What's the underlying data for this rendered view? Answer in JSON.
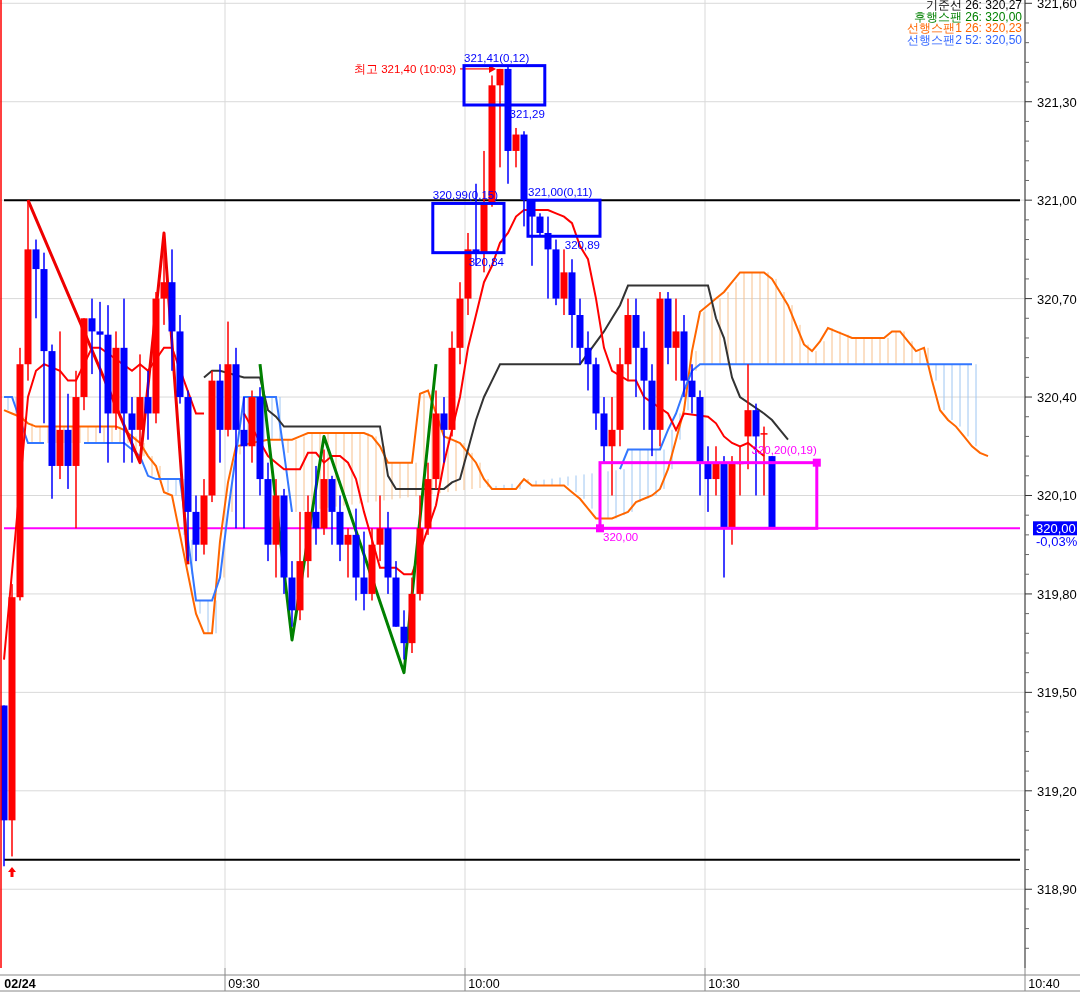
{
  "legend": [
    {
      "text": "기준선 26: 320,27",
      "color": "#000000"
    },
    {
      "text": "후행스팬 26: 320,00",
      "color": "#008000"
    },
    {
      "text": "선행스팬1 26: 320,23",
      "color": "#ff6600"
    },
    {
      "text": "선행스팬2 52: 320,50",
      "color": "#3366ff"
    }
  ],
  "last_price": {
    "text": "320,00",
    "change": "-0,03%"
  },
  "price_chart": {
    "chart_data": {
      "type": "candlestick",
      "ylim": [
        318.66,
        321.61
      ],
      "yticks": [
        {
          "value": 321.6,
          "label": "321,60"
        },
        {
          "value": 321.3,
          "label": "321,30"
        },
        {
          "value": 321.0,
          "label": "321,00"
        },
        {
          "value": 320.7,
          "label": "320,70"
        },
        {
          "value": 320.4,
          "label": "320,40"
        },
        {
          "value": 320.1,
          "label": "320,10"
        },
        {
          "value": 319.8,
          "label": "319,80"
        },
        {
          "value": 319.5,
          "label": "319,50"
        },
        {
          "value": 319.2,
          "label": "319,20"
        },
        {
          "value": 318.9,
          "label": "318,90"
        }
      ],
      "categories": [
        null,
        null,
        "02/24",
        null,
        null,
        null,
        null,
        null,
        null,
        null,
        null,
        null,
        null,
        null,
        null,
        null,
        null,
        null,
        null,
        null,
        null,
        null,
        null,
        null,
        null,
        null,
        null,
        null,
        null,
        null,
        "09:30",
        null,
        null,
        null,
        null,
        null,
        null,
        null,
        null,
        null,
        null,
        null,
        null,
        null,
        null,
        null,
        null,
        null,
        null,
        null,
        null,
        null,
        null,
        null,
        null,
        null,
        null,
        null,
        null,
        null,
        "10:00",
        null,
        null,
        null,
        null,
        null,
        null,
        null,
        null,
        null,
        null,
        null,
        null,
        null,
        null,
        null,
        null,
        null,
        null,
        null,
        null,
        null,
        null,
        null,
        null,
        null,
        null,
        null,
        null,
        null,
        "10:30",
        null,
        null,
        null,
        null,
        null,
        null,
        null,
        null,
        null,
        null,
        null,
        null,
        null,
        null,
        null,
        null,
        null,
        null,
        null,
        null,
        null,
        null,
        null,
        null,
        null,
        null,
        null,
        null,
        null,
        null,
        null,
        null,
        null,
        null,
        null,
        null,
        null,
        null,
        null,
        "10:40"
      ],
      "ohlc": [
        [
          319.46,
          319.46,
          318.97,
          319.11
        ],
        [
          319.11,
          319.83,
          319.0,
          319.79
        ],
        [
          319.79,
          320.55,
          319.78,
          320.5
        ],
        [
          320.5,
          321.0,
          320.45,
          320.85
        ],
        [
          320.85,
          320.88,
          320.64,
          320.79
        ],
        [
          320.79,
          320.84,
          320.32,
          320.54
        ],
        [
          320.54,
          320.56,
          320.09,
          320.19
        ],
        [
          320.19,
          320.6,
          320.15,
          320.3
        ],
        [
          320.3,
          320.41,
          320.12,
          320.19
        ],
        [
          320.19,
          320.48,
          320.0,
          320.4
        ],
        [
          320.4,
          320.64,
          320.36,
          320.64
        ],
        [
          320.64,
          320.7,
          320.47,
          320.6
        ],
        [
          320.6,
          320.69,
          320.29,
          320.59
        ],
        [
          320.59,
          320.68,
          320.2,
          320.35
        ],
        [
          320.35,
          320.6,
          320.3,
          320.55
        ],
        [
          320.55,
          320.7,
          320.2,
          320.35
        ],
        [
          320.35,
          320.4,
          320.2,
          320.3
        ],
        [
          320.3,
          320.53,
          320.25,
          320.4
        ],
        [
          320.4,
          320.48,
          320.27,
          320.35
        ],
        [
          320.35,
          320.72,
          320.32,
          320.7
        ],
        [
          320.7,
          320.9,
          320.62,
          320.75
        ],
        [
          320.75,
          320.85,
          320.48,
          320.6
        ],
        [
          320.6,
          320.65,
          320.38,
          320.4
        ],
        [
          320.4,
          320.42,
          319.9,
          320.05
        ],
        [
          320.05,
          320.1,
          319.9,
          319.95
        ],
        [
          319.95,
          320.15,
          319.92,
          320.1
        ],
        [
          320.1,
          320.48,
          320.08,
          320.45
        ],
        [
          320.45,
          320.5,
          320.2,
          320.3
        ],
        [
          320.3,
          320.63,
          320.28,
          320.5
        ],
        [
          320.5,
          320.55,
          320.0,
          320.3
        ],
        [
          320.3,
          320.4,
          320.0,
          320.25
        ],
        [
          320.25,
          320.42,
          320.2,
          320.4
        ],
        [
          320.4,
          320.43,
          320.1,
          320.15
        ],
        [
          320.15,
          320.2,
          319.9,
          319.95
        ],
        [
          319.95,
          320.15,
          319.85,
          320.1
        ],
        [
          320.1,
          320.12,
          319.8,
          319.85
        ],
        [
          319.85,
          319.9,
          319.7,
          319.75
        ],
        [
          319.75,
          320.05,
          319.72,
          319.9
        ],
        [
          319.9,
          320.1,
          319.85,
          320.05
        ],
        [
          320.05,
          320.19,
          319.95,
          320.0
        ],
        [
          320.0,
          320.24,
          319.98,
          320.15
        ],
        [
          320.15,
          320.16,
          319.95,
          320.05
        ],
        [
          320.05,
          320.1,
          319.9,
          319.95
        ],
        [
          319.95,
          320.0,
          319.85,
          319.98
        ],
        [
          319.98,
          320.06,
          319.78,
          319.85
        ],
        [
          319.85,
          319.99,
          319.75,
          319.8
        ],
        [
          319.8,
          320.0,
          319.78,
          319.95
        ],
        [
          319.95,
          320.1,
          319.9,
          320.0
        ],
        [
          320.0,
          320.05,
          319.8,
          319.85
        ],
        [
          319.85,
          319.9,
          319.7,
          319.7
        ],
        [
          319.7,
          319.75,
          319.6,
          319.65
        ],
        [
          319.65,
          319.85,
          319.62,
          319.8
        ],
        [
          319.8,
          320.1,
          319.78,
          320.0
        ],
        [
          320.0,
          320.2,
          319.98,
          320.15
        ],
        [
          320.15,
          320.42,
          320.12,
          320.35
        ],
        [
          320.35,
          320.4,
          320.2,
          320.3
        ],
        [
          320.3,
          320.6,
          320.28,
          320.55
        ],
        [
          320.55,
          320.75,
          320.5,
          320.7
        ],
        [
          320.7,
          320.9,
          320.65,
          320.85
        ],
        [
          320.85,
          321.05,
          320.8,
          320.84
        ],
        [
          320.84,
          321.15,
          320.78,
          320.99
        ],
        [
          320.99,
          321.38,
          320.98,
          321.35
        ],
        [
          321.35,
          321.4,
          321.1,
          321.4
        ],
        [
          321.4,
          321.41,
          321.05,
          321.15
        ],
        [
          321.15,
          321.22,
          321.1,
          321.2
        ],
        [
          321.2,
          321.21,
          320.92,
          321.0
        ],
        [
          321.0,
          321.0,
          320.8,
          320.95
        ],
        [
          320.95,
          320.96,
          320.89,
          320.9
        ],
        [
          320.9,
          320.95,
          320.7,
          320.85
        ],
        [
          320.85,
          320.88,
          320.68,
          320.7
        ],
        [
          320.7,
          320.85,
          320.65,
          320.78
        ],
        [
          320.78,
          320.82,
          320.55,
          320.65
        ],
        [
          320.65,
          320.7,
          320.5,
          320.55
        ],
        [
          320.55,
          320.6,
          320.42,
          320.5
        ],
        [
          320.5,
          320.52,
          320.3,
          320.35
        ],
        [
          320.35,
          320.4,
          320.2,
          320.25
        ],
        [
          320.25,
          320.4,
          320.1,
          320.3
        ],
        [
          320.3,
          320.55,
          320.25,
          320.5
        ],
        [
          320.5,
          320.7,
          320.45,
          320.65
        ],
        [
          320.65,
          320.7,
          320.4,
          320.55
        ],
        [
          320.55,
          320.6,
          320.3,
          320.45
        ],
        [
          320.45,
          320.5,
          320.22,
          320.3
        ],
        [
          320.3,
          320.72,
          320.25,
          320.7
        ],
        [
          320.7,
          320.72,
          320.5,
          320.55
        ],
        [
          320.55,
          320.7,
          320.45,
          320.6
        ],
        [
          320.6,
          320.65,
          320.4,
          320.45
        ],
        [
          320.45,
          320.5,
          320.35,
          320.4
        ],
        [
          320.4,
          320.42,
          320.1,
          320.2
        ],
        [
          320.2,
          320.25,
          320.05,
          320.15
        ],
        [
          320.15,
          320.25,
          320.1,
          320.2
        ],
        [
          320.2,
          320.22,
          319.85,
          320.0
        ],
        [
          320.0,
          320.22,
          319.95,
          320.2
        ],
        [
          320.2,
          320.25,
          320.1,
          320.2
        ],
        [
          320.28,
          320.5,
          320.18,
          320.36
        ],
        [
          320.36,
          320.38,
          320.1,
          320.28
        ],
        [
          320.29,
          320.31,
          320.1,
          320.29
        ],
        [
          320.22,
          320.22,
          320.0,
          320.0
        ],
        null,
        null,
        null,
        null,
        null,
        null,
        null,
        null,
        null,
        null,
        null,
        null,
        null,
        null,
        null,
        null,
        null,
        null,
        null,
        null,
        null,
        null,
        null,
        null,
        null,
        null,
        null,
        null,
        null,
        null,
        null,
        null,
        null,
        null
      ],
      "annotations": [
        "최고 321,40 (10:03)",
        "321,41(0,12)",
        "321,29",
        "320,99(0,15)",
        "320,84",
        "321,00(0,11)",
        "320,89",
        "320,20(0,19)",
        "320,00"
      ]
    }
  },
  "indicator_chart": {
    "chart_data": {
      "type": "line",
      "grid": true,
      "ylim": [
        318.66,
        321.61
      ],
      "series": [
        {
          "color": "#ff6600",
          "values": [
            320.36,
            320.35,
            320.34,
            320.32,
            320.31,
            320.31,
            null,
            320.31,
            320.31,
            null,
            320.31,
            320.31,
            320.31,
            320.31,
            320.31,
            320.3,
            320.28,
            320.26,
            320.22,
            320.19,
            320.11,
            320.1,
            319.98,
            319.86,
            319.74,
            319.68,
            319.68,
            319.96,
            320.14,
            320.25,
            null,
            null,
            null,
            320.27,
            320.27,
            320.27,
            320.27,
            320.28,
            320.29,
            320.29,
            320.29,
            320.29,
            320.29,
            320.29,
            320.29,
            320.29,
            320.28,
            320.25,
            320.2,
            320.2,
            320.2,
            320.2,
            320.41,
            320.42,
            null,
            320.28,
            320.27,
            320.26,
            320.23,
            320.2,
            320.15,
            320.12,
            320.12,
            320.12,
            320.12,
            320.15,
            320.13,
            320.13,
            320.13,
            320.13,
            320.13,
            320.11,
            320.09,
            320.06,
            320.03,
            320.03,
            320.03,
            320.04,
            320.05,
            320.08,
            320.09,
            320.1,
            320.12,
            320.18,
            320.27,
            320.36,
            320.54,
            320.66,
            320.68,
            320.7,
            320.72,
            320.75,
            320.78,
            320.78,
            320.78,
            320.78,
            320.76,
            320.72,
            320.68,
            320.62,
            320.56,
            320.54,
            320.57,
            320.61,
            320.6,
            320.59,
            320.58,
            320.58,
            320.58,
            320.58,
            320.58,
            320.6,
            320.6,
            320.57,
            320.54,
            320.55,
            320.45,
            320.36,
            320.33,
            320.31,
            320.28,
            320.25,
            320.23,
            320.22,
            null,
            null,
            null,
            null,
            null,
            null,
            null
          ]
        },
        {
          "color": "#3377ff",
          "values": [
            320.4,
            320.4,
            null,
            320.26,
            320.26,
            320.26,
            null,
            null,
            null,
            null,
            320.26,
            320.26,
            320.26,
            320.26,
            320.26,
            320.26,
            320.24,
            320.22,
            320.16,
            320.15,
            320.15,
            320.15,
            320.15,
            null,
            319.78,
            319.78,
            319.78,
            319.85,
            320.05,
            null,
            320.4,
            null,
            null,
            320.4,
            320.4,
            320.23,
            320.05,
            null,
            null,
            null,
            null,
            null,
            null,
            null,
            null,
            null,
            null,
            null,
            null,
            null,
            null,
            null,
            null,
            null,
            null,
            null,
            null,
            null,
            null,
            null,
            null,
            null,
            null,
            null,
            null,
            null,
            null,
            null,
            null,
            null,
            null,
            null,
            null,
            null,
            null,
            null,
            null,
            320.18,
            320.24,
            320.24,
            320.24,
            320.24,
            320.24,
            320.3,
            320.35,
            320.42,
            320.48,
            320.5,
            320.5,
            320.5,
            320.5,
            320.5,
            320.5,
            320.5,
            320.5,
            320.5,
            320.5,
            320.5,
            320.5,
            320.5,
            320.5,
            320.5,
            320.5,
            320.5,
            320.5,
            320.5,
            320.5,
            320.5,
            320.5,
            320.5,
            320.5,
            320.5,
            320.5,
            320.5,
            320.5,
            320.5,
            320.5,
            320.5,
            320.5,
            320.5,
            320.5,
            320.5,
            null,
            null,
            null,
            null,
            null,
            null,
            null
          ]
        },
        {
          "color": "#333333",
          "values": [
            null,
            null,
            null,
            null,
            null,
            null,
            null,
            null,
            null,
            null,
            null,
            null,
            null,
            null,
            null,
            null,
            null,
            null,
            null,
            null,
            null,
            null,
            null,
            null,
            null,
            320.46,
            320.48,
            320.48,
            null,
            null,
            320.46,
            320.46,
            320.46,
            320.36,
            320.34,
            320.31,
            320.31,
            320.31,
            320.31,
            320.31,
            320.31,
            320.31,
            320.31,
            320.31,
            320.31,
            320.31,
            320.31,
            320.31,
            320.16,
            320.12,
            320.12,
            320.12,
            320.12,
            null,
            320.12,
            320.12,
            320.14,
            320.15,
            null,
            320.33,
            320.4,
            320.45,
            320.5,
            320.5,
            320.5,
            320.5,
            320.5,
            320.5,
            320.5,
            320.5,
            320.5,
            320.5,
            320.5,
            null,
            null,
            320.6,
            320.64,
            320.68,
            320.74,
            320.74,
            320.74,
            320.74,
            320.74,
            320.74,
            320.74,
            320.74,
            320.74,
            320.74,
            320.74,
            320.64,
            320.58,
            320.46,
            320.4,
            null,
            null,
            320.35,
            320.33,
            320.3,
            320.27,
            null,
            null,
            null,
            null,
            null,
            null,
            null,
            null,
            null,
            null,
            null,
            null,
            null,
            null,
            null,
            null,
            null,
            null,
            null,
            null,
            null,
            null,
            null,
            null,
            null,
            null,
            null,
            null,
            null,
            null,
            null,
            null
          ]
        },
        {
          "color": "#ff0000",
          "values": [
            319.6,
            null,
            null,
            320.4,
            320.48,
            320.5,
            null,
            320.48,
            320.45,
            320.45,
            null,
            320.55,
            320.55,
            null,
            null,
            null,
            320.48,
            320.5,
            320.48,
            null,
            320.55,
            320.55,
            null,
            null,
            320.35,
            320.35,
            null,
            null,
            null,
            null,
            320.35,
            null,
            null,
            320.22,
            320.2,
            320.18,
            320.18,
            320.18,
            320.23,
            320.23,
            320.2,
            320.22,
            320.22,
            320.2,
            320.15,
            320.05,
            null,
            319.88,
            null,
            319.88,
            319.86,
            319.86,
            null,
            null,
            320.07,
            320.2,
            null,
            320.4,
            320.55,
            320.65,
            320.75,
            320.8,
            320.87,
            320.9,
            320.95,
            320.97,
            null,
            320.97,
            320.97,
            320.96,
            320.95,
            320.93,
            320.86,
            320.82,
            320.7,
            320.55,
            320.48,
            null,
            320.45,
            320.45,
            320.4,
            null,
            null,
            320.35,
            320.3,
            320.35,
            null,
            null,
            320.34,
            320.32,
            320.28,
            320.26,
            320.25,
            320.26,
            320.24,
            320.22,
            null,
            null,
            null,
            null,
            null,
            null,
            null,
            null,
            null,
            null,
            null,
            null,
            null,
            null,
            null,
            null,
            null,
            null,
            null,
            null,
            null,
            null,
            null,
            null,
            null,
            null,
            null,
            null,
            null,
            null,
            null,
            null,
            null,
            null,
            null
          ]
        },
        {
          "color": "#ee0000",
          "values": [
            null,
            null,
            null,
            321.0,
            null,
            null,
            null,
            null,
            null,
            null,
            null,
            null,
            null,
            null,
            null,
            null,
            null,
            320.2,
            null,
            null,
            320.9,
            null,
            null,
            319.89,
            null,
            null,
            null,
            null,
            null,
            null,
            null,
            null,
            null,
            null,
            null,
            null,
            null,
            null,
            null,
            null,
            null,
            null,
            null,
            null,
            null,
            null,
            null,
            null,
            null,
            null,
            null,
            null,
            null,
            null,
            null,
            null,
            null,
            null,
            null,
            null,
            null,
            null,
            null,
            null,
            null,
            null,
            null,
            null,
            null,
            null,
            null,
            null,
            null,
            null,
            null,
            null,
            null,
            null,
            null,
            null,
            null,
            null,
            null,
            null,
            null,
            null,
            null,
            null,
            null,
            null,
            null,
            null,
            null,
            null,
            null,
            null,
            null,
            null,
            null,
            null,
            null,
            null,
            null,
            null,
            null,
            null,
            null,
            null,
            null,
            null,
            null,
            null,
            null,
            null,
            null,
            null,
            null,
            null,
            null,
            null,
            null,
            null,
            null,
            null,
            null,
            null,
            null,
            null,
            null,
            null,
            null
          ]
        },
        {
          "color": "#008000",
          "values": [
            null,
            null,
            null,
            null,
            null,
            null,
            null,
            null,
            null,
            null,
            null,
            null,
            null,
            null,
            null,
            null,
            null,
            null,
            null,
            null,
            null,
            null,
            null,
            null,
            null,
            null,
            null,
            null,
            null,
            null,
            null,
            null,
            320.5,
            null,
            null,
            null,
            319.66,
            null,
            null,
            null,
            320.28,
            null,
            null,
            null,
            null,
            null,
            null,
            null,
            null,
            null,
            319.56,
            null,
            null,
            null,
            320.5,
            null,
            null,
            null,
            null,
            null,
            null,
            null,
            null,
            null,
            null,
            null,
            null,
            null,
            null,
            null,
            null,
            null,
            null,
            null,
            null,
            null,
            null,
            null,
            null,
            null,
            null,
            null,
            null,
            null,
            null,
            null,
            null,
            null,
            null,
            null,
            null,
            null,
            null,
            null,
            null,
            null,
            null,
            null,
            null,
            null,
            null,
            null,
            null,
            null,
            null,
            null,
            null,
            null,
            null,
            null,
            null,
            null,
            null,
            null,
            null,
            null,
            null,
            null,
            null,
            null,
            null,
            null,
            null,
            null,
            null,
            null,
            null,
            null,
            null,
            null,
            null
          ]
        },
        {
          "color": "#000000",
          "values": [
            321.0,
            321.0,
            321.0,
            null,
            321.0,
            321.0,
            321.0,
            321.0,
            321.0,
            321.0,
            321.0,
            321.0,
            321.0,
            321.0,
            321.0,
            321.0,
            321.0,
            321.0,
            321.0,
            321.0,
            321.0,
            321.0,
            321.0,
            321.0,
            321.0,
            321.0,
            321.0,
            321.0,
            321.0,
            321.0,
            321.0,
            321.0,
            321.0,
            321.0,
            321.0,
            321.0,
            321.0,
            321.0,
            321.0,
            321.0,
            321.0,
            321.0,
            321.0,
            321.0,
            321.0,
            321.0,
            321.0,
            321.0,
            321.0,
            321.0,
            321.0,
            321.0,
            321.0,
            321.0,
            null,
            null,
            null,
            null,
            null,
            null,
            null,
            null,
            null,
            321.0,
            321.0,
            null,
            null,
            null,
            null,
            null,
            null,
            null,
            null,
            null,
            null,
            321.0,
            321.0,
            321.0,
            321.0,
            321.0,
            321.0,
            321.0,
            321.0,
            321.0,
            321.0,
            321.0,
            321.0,
            321.0,
            321.0,
            321.0,
            321.0,
            321.0,
            321.0,
            321.0,
            321.0,
            321.0,
            321.0,
            321.0,
            321.0,
            321.0,
            321.0,
            321.0,
            321.0,
            321.0,
            321.0,
            321.0,
            321.0,
            321.0,
            321.0,
            321.0,
            321.0,
            321.0,
            321.0,
            321.0,
            321.0,
            321.0,
            321.0,
            321.0,
            321.0,
            321.0,
            321.0,
            321.0,
            321.0,
            321.0,
            321.0,
            321.0,
            321.0,
            321.0,
            null,
            null,
            null
          ]
        },
        {
          "color": "#000000",
          "values": [
            318.99,
            318.99,
            318.99,
            318.99,
            318.99,
            318.99,
            318.99,
            318.99,
            318.99,
            318.99,
            318.99,
            318.99,
            318.99,
            318.99,
            318.99,
            318.99,
            318.99,
            318.99,
            318.99,
            318.99,
            318.99,
            318.99,
            318.99,
            318.99,
            318.99,
            318.99,
            318.99,
            318.99,
            318.99,
            318.99,
            318.99,
            318.99,
            318.99,
            318.99,
            318.99,
            318.99,
            318.99,
            318.99,
            318.99,
            318.99,
            318.99,
            318.99,
            318.99,
            318.99,
            318.99,
            318.99,
            318.99,
            318.99,
            318.99,
            318.99,
            318.99,
            318.99,
            318.99,
            318.99,
            318.99,
            318.99,
            318.99,
            318.99,
            318.99,
            318.99,
            318.99,
            318.99,
            318.99,
            318.99,
            318.99,
            318.99,
            318.99,
            318.99,
            318.99,
            318.99,
            318.99,
            318.99,
            318.99,
            318.99,
            318.99,
            318.99,
            318.99,
            318.99,
            318.99,
            318.99,
            318.99,
            318.99,
            318.99,
            318.99,
            318.99,
            318.99,
            318.99,
            318.99,
            318.99,
            318.99,
            318.99,
            318.99,
            318.99,
            318.99,
            318.99,
            318.99,
            318.99,
            318.99,
            318.99,
            318.99,
            318.99,
            318.99,
            318.99,
            318.99,
            318.99,
            318.99,
            318.99,
            318.99,
            318.99,
            318.99,
            318.99,
            318.99,
            318.99,
            318.99,
            318.99,
            318.99,
            318.99,
            318.99,
            318.99,
            318.99,
            318.99,
            318.99,
            318.99,
            318.99,
            318.99,
            318.99,
            318.99,
            318.99,
            null,
            null,
            null
          ]
        },
        {
          "color": "#ff00ff",
          "values": [
            320.0,
            320.0,
            null,
            320.0,
            320.0,
            320.0,
            320.0,
            320.0,
            320.0,
            320.0,
            320.0,
            320.0,
            320.0,
            320.0,
            320.0,
            320.0,
            320.0,
            320.0,
            320.0,
            320.0,
            320.0,
            320.0,
            320.0,
            320.0,
            null,
            null,
            320.0,
            320.0,
            320.0,
            320.0,
            320.0,
            320.0,
            320.0,
            null,
            null,
            null,
            320.0,
            320.0,
            null,
            null,
            null,
            320.0,
            null,
            320.0,
            320.0,
            320.0,
            320.0,
            null,
            null,
            320.0,
            320.0,
            320.0,
            null,
            null,
            320.0,
            320.0,
            320.0,
            320.0,
            320.0,
            320.0,
            320.0,
            320.0,
            320.0,
            320.0,
            320.0,
            320.0,
            320.0,
            320.0,
            320.0,
            320.0,
            320.0,
            320.0,
            320.0,
            320.0,
            null,
            null,
            null,
            null,
            null,
            null,
            null,
            null,
            null,
            null,
            null,
            null,
            null,
            null,
            null,
            null,
            null,
            null,
            null,
            null,
            null,
            null,
            null,
            null,
            null,
            null,
            null,
            null,
            320.0,
            320.0,
            320.0,
            320.0,
            320.0,
            320.0,
            320.0,
            320.0,
            320.0,
            320.0,
            320.0,
            320.0,
            320.0,
            320.0,
            320.0,
            320.0,
            320.0,
            320.0,
            320.0,
            320.0,
            320.0,
            320.0,
            320.0,
            320.0,
            320.0,
            320.0,
            null,
            null,
            null
          ]
        }
      ]
    }
  }
}
